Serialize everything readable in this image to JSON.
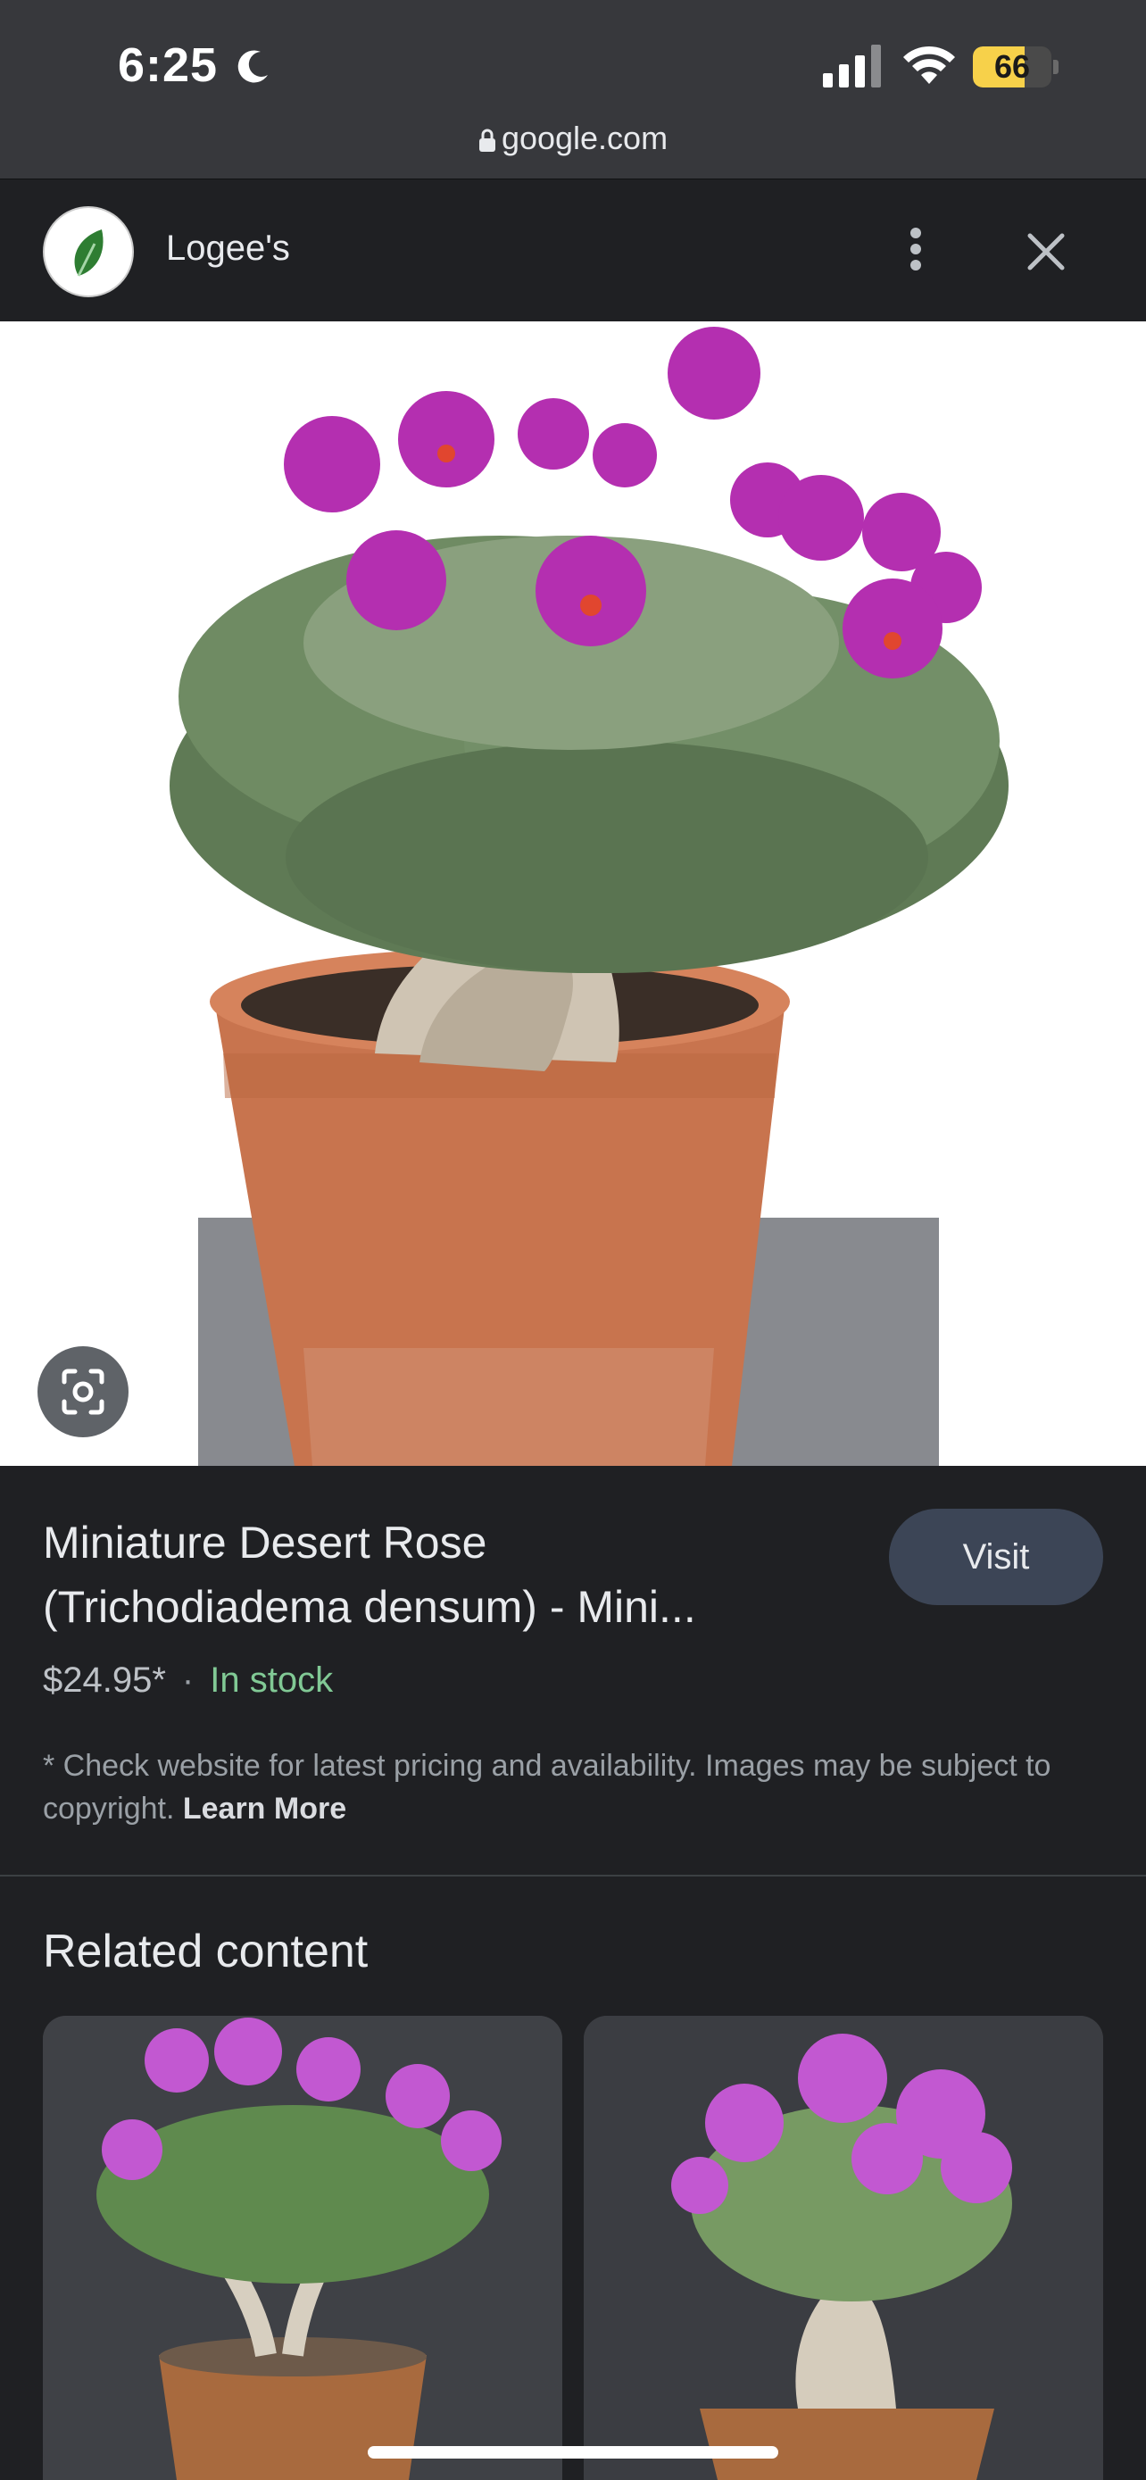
{
  "status_bar": {
    "time": "6:25",
    "battery_percent": "66",
    "battery_level": 0.66,
    "icons": [
      "moon-icon",
      "signal-icon",
      "wifi-icon",
      "battery-icon"
    ]
  },
  "url_bar": {
    "domain": "google.com",
    "icon": "lock-icon"
  },
  "panel_header": {
    "site_name": "Logee's",
    "logo_icon": "leaf-logo-icon",
    "menu_icon": "more-vert-icon",
    "close_icon": "close-icon"
  },
  "product": {
    "title_line1": "Miniature Desert Rose",
    "title_line2": "(Trichodiadema densum) - Mini...",
    "visit_label": "Visit",
    "price": "$24.95*",
    "separator": "·",
    "availability": "In stock",
    "disclaimer": "* Check website for latest pricing and availability. Images may be subject to copyright.",
    "learn_more": "Learn More"
  },
  "related": {
    "heading": "Related content"
  },
  "colors": {
    "background": "#1f2023",
    "visit_button": "#3c4556",
    "in_stock": "#81c995",
    "flower": "#b42fb0"
  }
}
